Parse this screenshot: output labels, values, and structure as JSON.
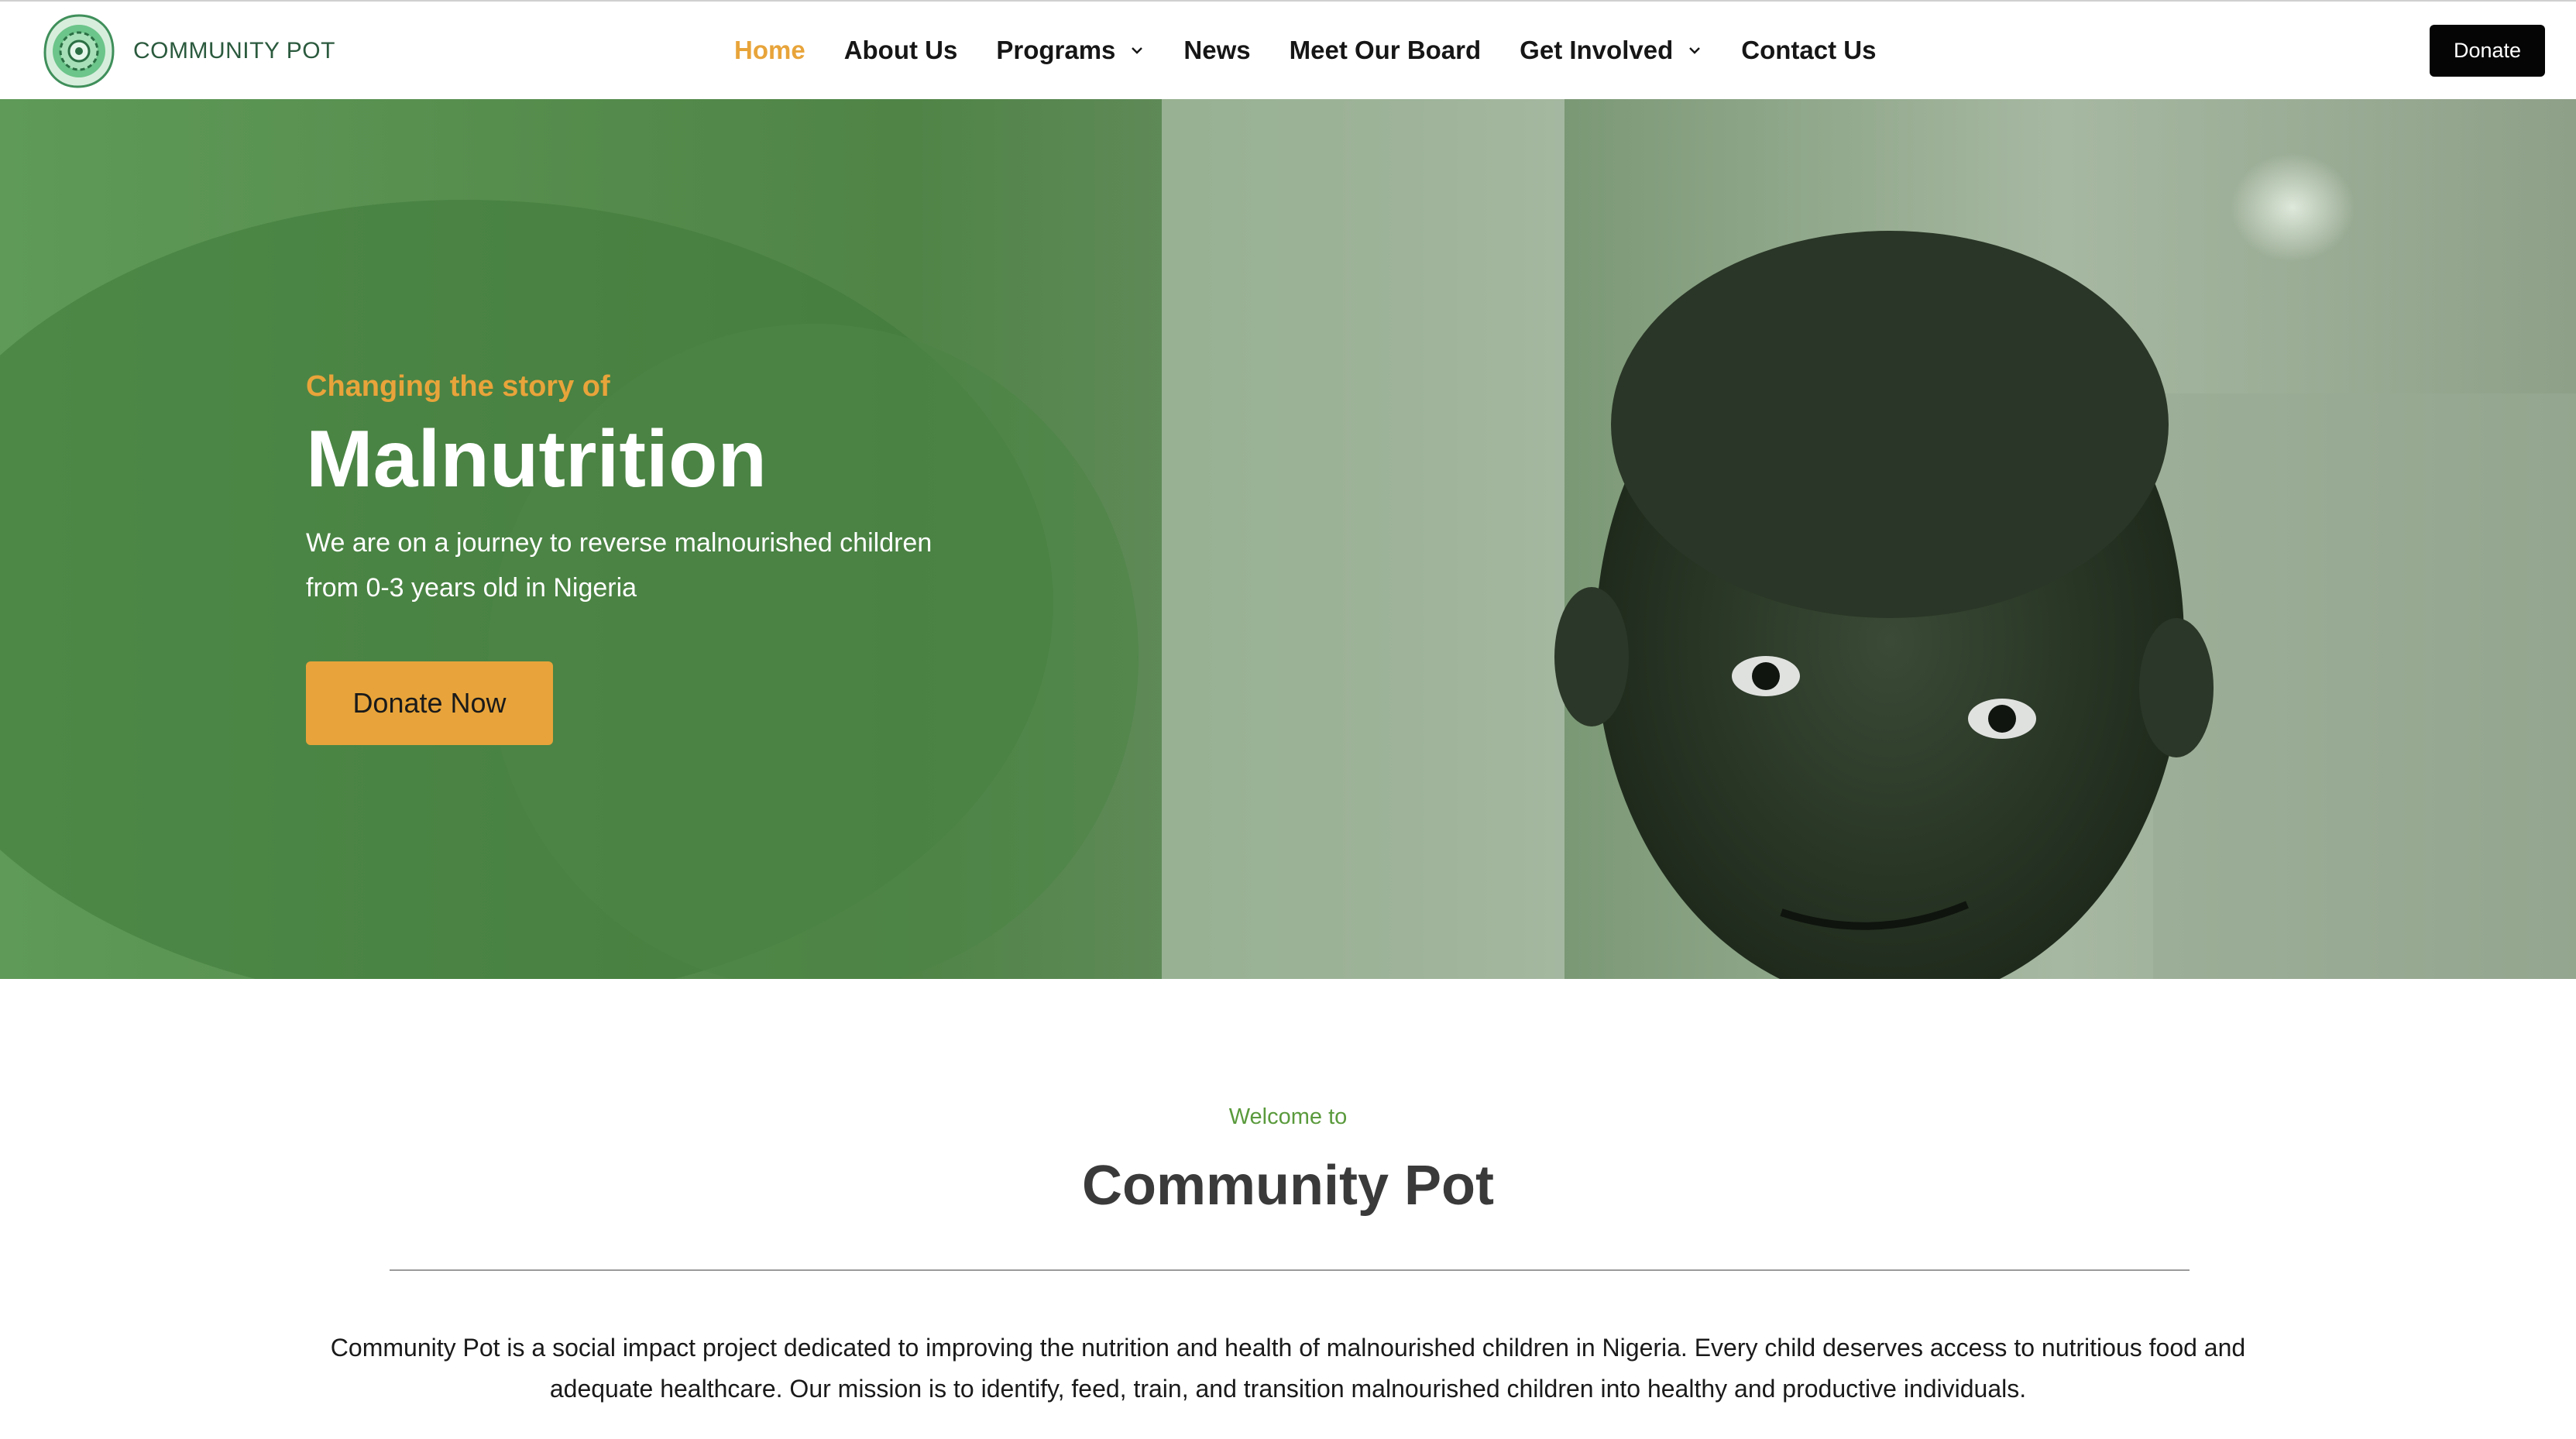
{
  "brand": {
    "name": "COMMUNITY POT",
    "colors": {
      "accent": "#e8a43a",
      "brand_green": "#2b5a3e",
      "welcome_green": "#5a9a3c",
      "dark": "#050505"
    }
  },
  "nav": {
    "items": [
      {
        "label": "Home",
        "active": true,
        "dropdown": false
      },
      {
        "label": "About Us",
        "active": false,
        "dropdown": false
      },
      {
        "label": "Programs",
        "active": false,
        "dropdown": true
      },
      {
        "label": "News",
        "active": false,
        "dropdown": false
      },
      {
        "label": "Meet Our Board",
        "active": false,
        "dropdown": false
      },
      {
        "label": "Get Involved",
        "active": false,
        "dropdown": true
      },
      {
        "label": "Contact Us",
        "active": false,
        "dropdown": false
      }
    ],
    "donate_label": "Donate"
  },
  "hero": {
    "kicker": "Changing the story of",
    "title": "Malnutrition",
    "description": "We are on a journey to reverse malnourished children from 0-3 years old in Nigeria",
    "cta_label": "Donate Now"
  },
  "welcome": {
    "kicker": "Welcome to",
    "title": "Community Pot",
    "body": "Community Pot is a social impact project dedicated to improving the nutrition and health of malnourished children in Nigeria. Every child deserves access to nutritious food and adequate healthcare. Our mission is to identify, feed, train, and transition malnourished children into healthy and productive individuals."
  },
  "icons": {
    "logo": "community-pot-logo-icon",
    "dropdown": "chevron-down-icon"
  }
}
